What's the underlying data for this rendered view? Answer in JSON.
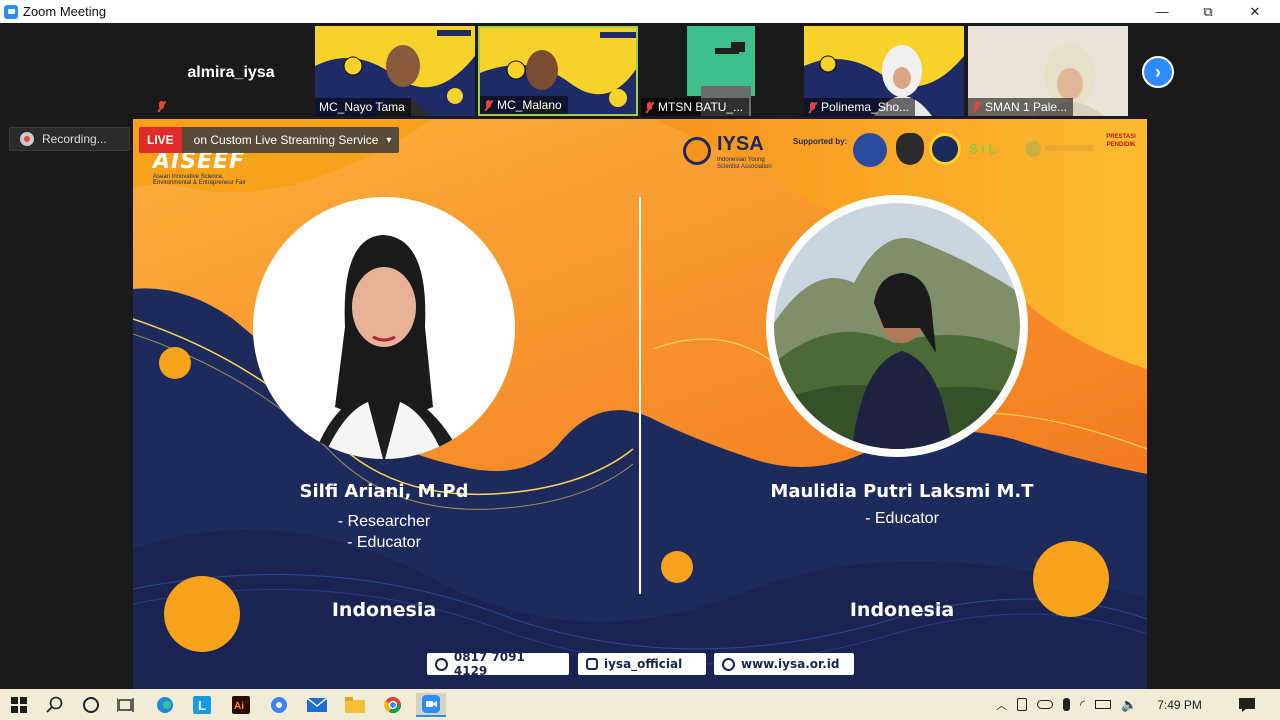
{
  "window": {
    "title": "Zoom Meeting",
    "controls": {
      "minimize": "—",
      "restore": "⧉",
      "close": "✕"
    }
  },
  "strip": {
    "self_name": "almira_iysa",
    "participants": [
      {
        "name": "MC_Nayo Tama"
      },
      {
        "name": "MC_Malano"
      },
      {
        "name": "MTSN BATU_..."
      },
      {
        "name": "Polinema_Sho..."
      },
      {
        "name": "SMAN 1 Pale..."
      }
    ],
    "next_label": "›"
  },
  "recording": {
    "label": "Recording..."
  },
  "live": {
    "badge": "LIVE",
    "text": "on Custom Live Streaming Service",
    "caret": "▾"
  },
  "slide": {
    "event_logo": "AISEEF",
    "event_sub1": "Asean Innovative Science,",
    "event_sub2": "Environmental & Entrepreneur Fair",
    "org_name": "IYSA",
    "org_sub1": "Indonesian Young",
    "org_sub2": "Scientist Association",
    "supported_by": "Supported by:",
    "sponsor_prestasi": "PRESTASI PENDIDIK",
    "left": {
      "name": "Silfi Ariani, M.Pd",
      "role1": "- Researcher",
      "role2": "- Educator",
      "country": "Indonesia"
    },
    "right": {
      "name": "Maulidia Putri Laksmi M.T",
      "role1": "- Educator",
      "country": "Indonesia"
    },
    "contacts": {
      "whatsapp": "0817 7091 4129",
      "instagram": "iysa_official",
      "web": "www.iysa.or.id"
    }
  },
  "taskbar": {
    "time": "7:49 PM"
  },
  "colors": {
    "zoom_blue": "#2d8cff",
    "live_red": "#e02b2b",
    "slide_orange": "#f7941d",
    "slide_navy": "#1c2a5c"
  }
}
